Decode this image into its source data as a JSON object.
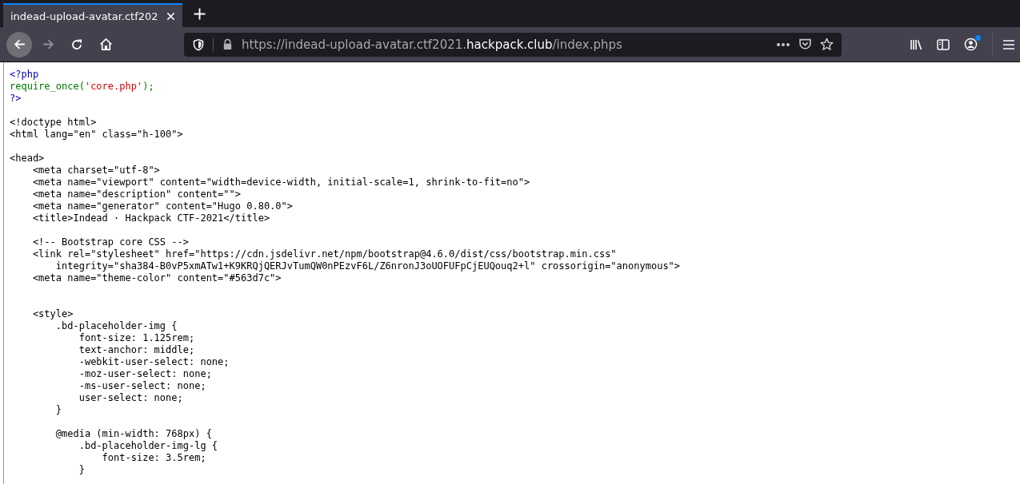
{
  "window": {
    "tabs": [
      {
        "title": "indead-upload-avatar.ctf202",
        "selected": true
      }
    ],
    "nav": {
      "back_disabled": false,
      "forward_disabled": true
    },
    "address_bar": {
      "url_prefix": "https://indead-upload-avatar.ctf2021.",
      "url_domain": "hackpack.club",
      "url_path": "/index.phps"
    },
    "account_badge": true
  },
  "source": {
    "lines": [
      {
        "kind": "code",
        "segments": [
          {
            "kind": "php-tag",
            "text": "<?php"
          }
        ]
      },
      {
        "kind": "code",
        "segments": [
          {
            "kind": "php-code",
            "text": "require_once("
          },
          {
            "kind": "php-string",
            "text": "'core.php'"
          },
          {
            "kind": "php-code",
            "text": ");"
          }
        ]
      },
      {
        "kind": "code",
        "segments": [
          {
            "kind": "php-tag",
            "text": "?>"
          }
        ]
      },
      {
        "kind": "blank"
      },
      {
        "kind": "code",
        "segments": [
          {
            "kind": "plain",
            "text": "<!doctype html>"
          }
        ]
      },
      {
        "kind": "code",
        "segments": [
          {
            "kind": "plain",
            "text": "<html lang=\"en\" class=\"h-100\">"
          }
        ]
      },
      {
        "kind": "blank"
      },
      {
        "kind": "code",
        "segments": [
          {
            "kind": "plain",
            "text": "<head>"
          }
        ]
      },
      {
        "kind": "code",
        "segments": [
          {
            "kind": "plain",
            "text": "    <meta charset=\"utf-8\">"
          }
        ]
      },
      {
        "kind": "code",
        "segments": [
          {
            "kind": "plain",
            "text": "    <meta name=\"viewport\" content=\"width=device-width, initial-scale=1, shrink-to-fit=no\">"
          }
        ]
      },
      {
        "kind": "code",
        "segments": [
          {
            "kind": "plain",
            "text": "    <meta name=\"description\" content=\"\">"
          }
        ]
      },
      {
        "kind": "code",
        "segments": [
          {
            "kind": "plain",
            "text": "    <meta name=\"generator\" content=\"Hugo 0.80.0\">"
          }
        ]
      },
      {
        "kind": "code",
        "segments": [
          {
            "kind": "plain",
            "text": "    <title>Indead · Hackpack CTF-2021</title>"
          }
        ]
      },
      {
        "kind": "blank"
      },
      {
        "kind": "code",
        "segments": [
          {
            "kind": "plain",
            "text": "    <!-- Bootstrap core CSS -->"
          }
        ]
      },
      {
        "kind": "code",
        "segments": [
          {
            "kind": "plain",
            "text": "    <link rel=\"stylesheet\" href=\"https://cdn.jsdelivr.net/npm/bootstrap@4.6.0/dist/css/bootstrap.min.css\""
          }
        ]
      },
      {
        "kind": "code",
        "segments": [
          {
            "kind": "plain",
            "text": "        integrity=\"sha384-B0vP5xmATw1+K9KRQjQERJvTumQW0nPEzvF6L/Z6nronJ3oUOFUFpCjEUQouq2+l\" crossorigin=\"anonymous\">"
          }
        ]
      },
      {
        "kind": "code",
        "segments": [
          {
            "kind": "plain",
            "text": "    <meta name=\"theme-color\" content=\"#563d7c\">"
          }
        ]
      },
      {
        "kind": "blank"
      },
      {
        "kind": "blank"
      },
      {
        "kind": "code",
        "segments": [
          {
            "kind": "plain",
            "text": "    <style>"
          }
        ]
      },
      {
        "kind": "code",
        "segments": [
          {
            "kind": "plain",
            "text": "        .bd-placeholder-img {"
          }
        ]
      },
      {
        "kind": "code",
        "segments": [
          {
            "kind": "plain",
            "text": "            font-size: 1.125rem;"
          }
        ]
      },
      {
        "kind": "code",
        "segments": [
          {
            "kind": "plain",
            "text": "            text-anchor: middle;"
          }
        ]
      },
      {
        "kind": "code",
        "segments": [
          {
            "kind": "plain",
            "text": "            -webkit-user-select: none;"
          }
        ]
      },
      {
        "kind": "code",
        "segments": [
          {
            "kind": "plain",
            "text": "            -moz-user-select: none;"
          }
        ]
      },
      {
        "kind": "code",
        "segments": [
          {
            "kind": "plain",
            "text": "            -ms-user-select: none;"
          }
        ]
      },
      {
        "kind": "code",
        "segments": [
          {
            "kind": "plain",
            "text": "            user-select: none;"
          }
        ]
      },
      {
        "kind": "code",
        "segments": [
          {
            "kind": "plain",
            "text": "        }"
          }
        ]
      },
      {
        "kind": "blank"
      },
      {
        "kind": "code",
        "segments": [
          {
            "kind": "plain",
            "text": "        @media (min-width: 768px) {"
          }
        ]
      },
      {
        "kind": "code",
        "segments": [
          {
            "kind": "plain",
            "text": "            .bd-placeholder-img-lg {"
          }
        ]
      },
      {
        "kind": "code",
        "segments": [
          {
            "kind": "plain",
            "text": "                font-size: 3.5rem;"
          }
        ]
      },
      {
        "kind": "code",
        "segments": [
          {
            "kind": "plain",
            "text": "            }"
          }
        ]
      }
    ]
  }
}
